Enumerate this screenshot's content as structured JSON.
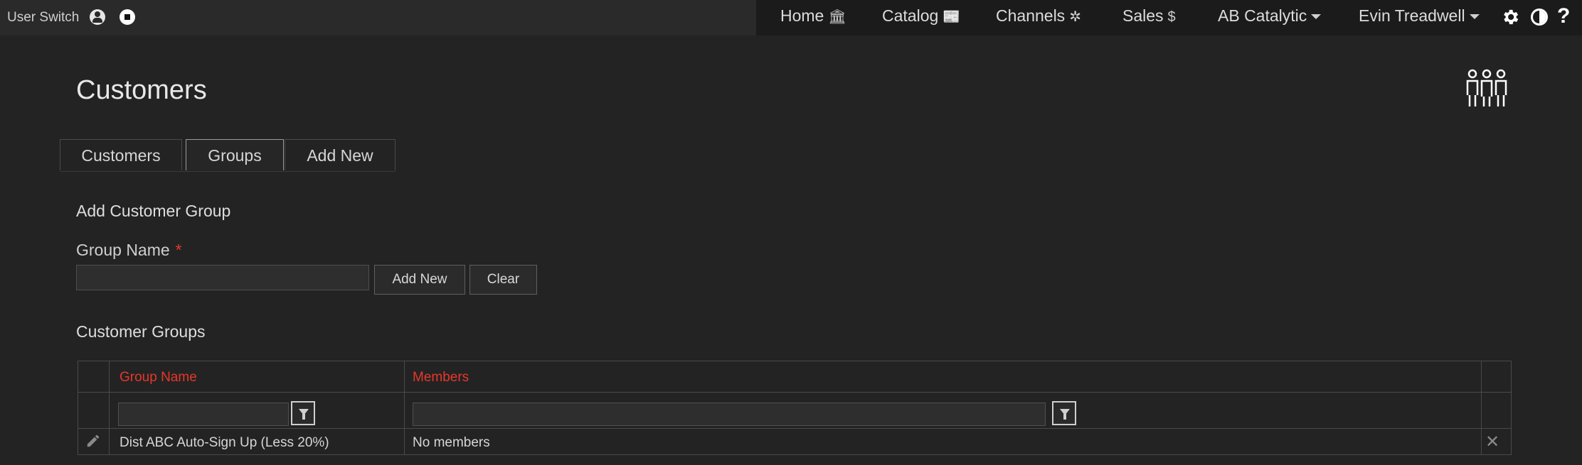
{
  "topbar": {
    "user_switch_label": "User Switch",
    "nav": [
      {
        "label": "Home",
        "icon": "building-icon"
      },
      {
        "label": "Catalog",
        "icon": "catalog-icon"
      },
      {
        "label": "Channels",
        "icon": "network-icon"
      },
      {
        "label": "Sales",
        "icon": "dollar-icon"
      }
    ],
    "nav_icon_glyphs": {
      "home": "🏛",
      "catalog": "📰",
      "channels": "✲",
      "sales": "$"
    },
    "org_selector": "AB Catalytic",
    "user_menu": "Evin Treadwell",
    "help_glyph": "?"
  },
  "page": {
    "title": "Customers"
  },
  "tabs": [
    {
      "label": "Customers",
      "active": false
    },
    {
      "label": "Groups",
      "active": true
    },
    {
      "label": "Add New",
      "active": false
    }
  ],
  "form": {
    "heading": "Add Customer Group",
    "group_name_label": "Group Name",
    "required_mark": "*",
    "group_name_value": "",
    "add_button": "Add New",
    "clear_button": "Clear"
  },
  "groups_table": {
    "heading": "Customer Groups",
    "columns": [
      "Group Name",
      "Members"
    ],
    "rows": [
      {
        "group_name": "Dist ABC Auto-Sign Up (Less 20%)",
        "members": "No members"
      }
    ]
  },
  "colors": {
    "accent_red": "#e8372a",
    "background": "#232323",
    "topbar": "#1b1b1b"
  }
}
